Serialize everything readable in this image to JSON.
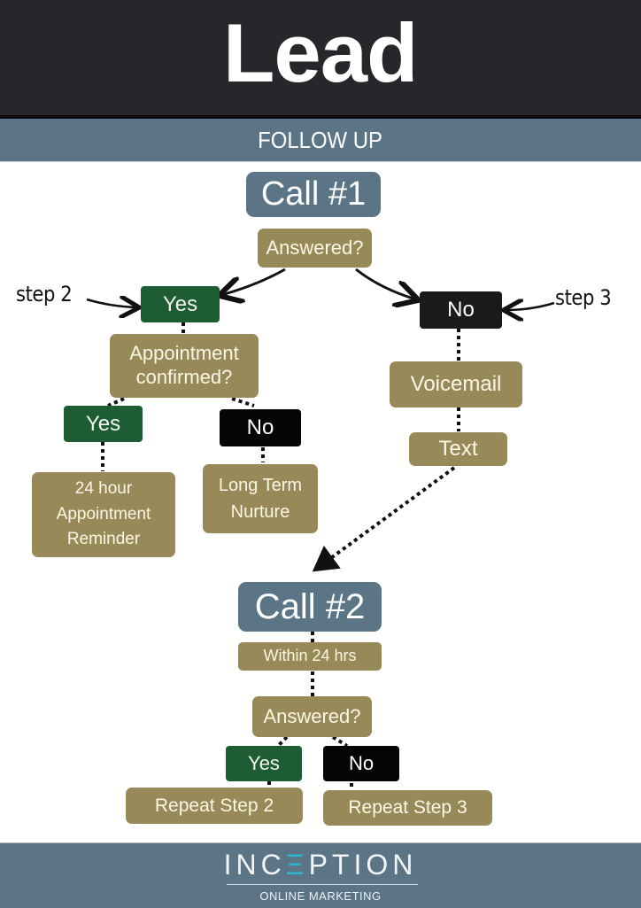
{
  "header": {
    "title": "Lead"
  },
  "subheader": {
    "text": "FOLLOW UP"
  },
  "flow": {
    "call1": "Call #1",
    "answered1": "Answered?",
    "step2_label": "step 2",
    "step3_label": "step 3",
    "yes1": "Yes",
    "no1": "No",
    "appt_confirmed_line1": "Appointment",
    "appt_confirmed_line2": "confirmed?",
    "yes2": "Yes",
    "no2": "No",
    "reminder_line1": "24 hour",
    "reminder_line2": "Appointment",
    "reminder_line3": "Reminder",
    "nurture_line1": "Long Term",
    "nurture_line2": "Nurture",
    "voicemail": "Voicemail",
    "text": "Text",
    "call2": "Call #2",
    "within": "Within 24 hrs",
    "answered2": "Answered?",
    "yes3": "Yes",
    "no3": "No",
    "repeat2": "Repeat Step 2",
    "repeat3": "Repeat Step 3"
  },
  "colors": {
    "header_bg": "#27272b",
    "band_blue": "#5b7486",
    "tan": "#978a58",
    "green": "#1e5d33",
    "black": "#1c1a19",
    "logo_accent": "#2bb7d3"
  },
  "footer": {
    "logo_pre": "INC",
    "logo_accent": "Ξ",
    "logo_post": "PTION",
    "tagline": "ONLINE MARKETING"
  }
}
